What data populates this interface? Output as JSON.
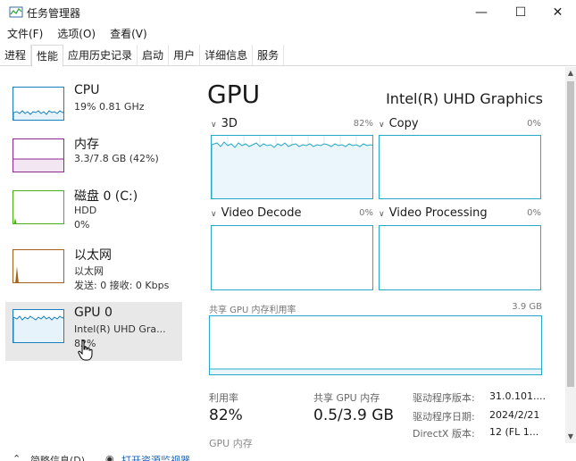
{
  "window": {
    "title": "任务管理器",
    "minimize_icon": "—",
    "maximize_icon": "☐",
    "close_icon": "✕"
  },
  "menu": [
    "文件(F)",
    "选项(O)",
    "查看(V)"
  ],
  "tabs": [
    "进程",
    "性能",
    "应用历史记录",
    "启动",
    "用户",
    "详细信息",
    "服务"
  ],
  "active_tab": "性能",
  "sidebar": {
    "items": [
      {
        "title": "CPU",
        "sub1": "19% 0.81 GHz",
        "sub2": "",
        "color": "#1a7fb8"
      },
      {
        "title": "内存",
        "sub1": "3.3/7.8 GB (42%)",
        "sub2": "",
        "color": "#8b2a8b"
      },
      {
        "title": "磁盘 0 (C:)",
        "sub1": "HDD",
        "sub2": "0%",
        "color": "#4caf1a"
      },
      {
        "title": "以太网",
        "sub1": "以太网",
        "sub2": "发送: 0 接收: 0 Kbps",
        "color": "#a5611a"
      },
      {
        "title": "GPU 0",
        "sub1": "Intel(R) UHD Gra...",
        "sub2": "82%",
        "color": "#1a7fb8"
      }
    ]
  },
  "main": {
    "title": "GPU",
    "device_name": "Intel(R) UHD Graphics",
    "graphs": [
      {
        "label": "3D",
        "percent": "82%"
      },
      {
        "label": "Copy",
        "percent": "0%"
      },
      {
        "label": "Video Decode",
        "percent": "0%"
      },
      {
        "label": "Video Processing",
        "percent": "0%"
      }
    ],
    "shared_mem_label": "共享 GPU 内存利用率",
    "shared_mem_max": "3.9 GB",
    "stats": {
      "utilization_label": "利用率",
      "utilization_value": "82%",
      "shared_gpu_mem_label": "共享 GPU 内存",
      "shared_gpu_mem_value": "0.5/3.9 GB"
    },
    "details": [
      {
        "label": "驱动程序版本:",
        "value": "31.0.101...."
      },
      {
        "label": "驱动程序日期:",
        "value": "2024/2/21"
      },
      {
        "label": "DirectX 版本:",
        "value": "12 (FL 1..."
      }
    ],
    "gpu_mem_label": "GPU 内存"
  },
  "footer": {
    "less_details": "简略信息(D)",
    "open_resource_monitor": "打开资源监视器"
  },
  "colors": {
    "accent": "#28a8c8",
    "selected_bg": "#e8e8e8"
  }
}
